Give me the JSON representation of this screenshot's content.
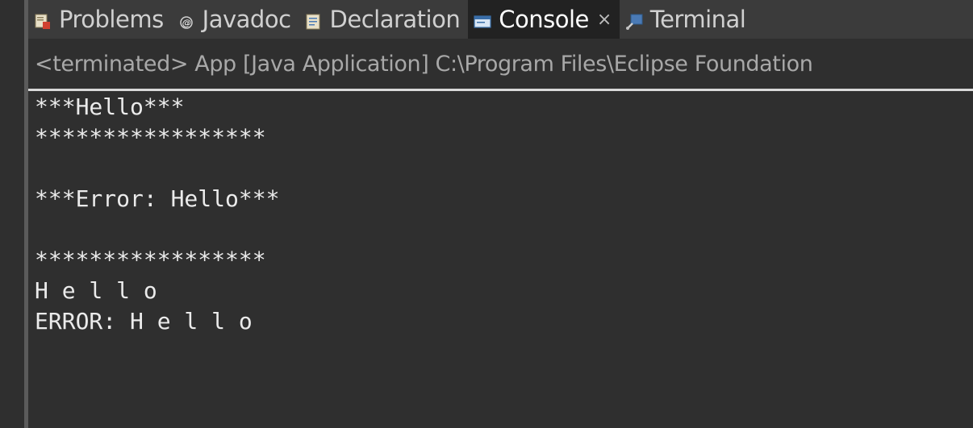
{
  "tabs": [
    {
      "id": "problems",
      "label": "Problems",
      "icon": "problems-icon",
      "active": false
    },
    {
      "id": "javadoc",
      "label": "Javadoc",
      "icon": "javadoc-icon",
      "active": false
    },
    {
      "id": "declaration",
      "label": "Declaration",
      "icon": "declaration-icon",
      "active": false
    },
    {
      "id": "console",
      "label": "Console",
      "icon": "console-icon",
      "active": true,
      "close_label": "×"
    },
    {
      "id": "terminal",
      "label": "Terminal",
      "icon": "terminal-icon",
      "active": false
    }
  ],
  "status": {
    "text": "<terminated> App [Java Application] C:\\Program Files\\Eclipse Foundation"
  },
  "console": {
    "lines": [
      "***Hello***",
      "*****************",
      "",
      "***Error: Hello***",
      "",
      "*****************",
      "H e l l o",
      "ERROR: H e l l o"
    ]
  },
  "colors": {
    "background": "#2f2f2f",
    "tab_bar": "#3b3b3b",
    "active_tab": "#222222",
    "text": "#ebebeb",
    "status_text": "#a8a8a8"
  }
}
